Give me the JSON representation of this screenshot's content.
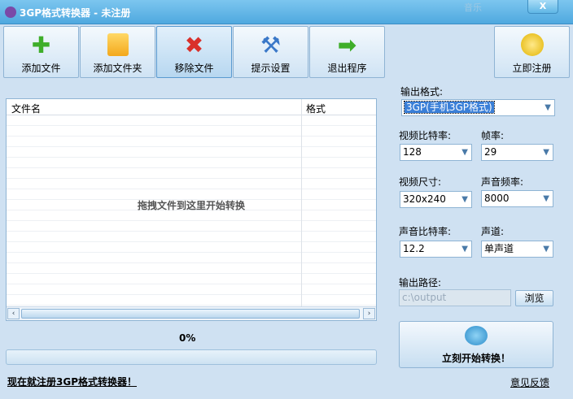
{
  "window": {
    "title": "3GP格式转换器 - 未注册",
    "music": "音乐",
    "close": "X"
  },
  "toolbar": [
    {
      "label": "添加文件",
      "icon": "plus-icon"
    },
    {
      "label": "添加文件夹",
      "icon": "folder-icon"
    },
    {
      "label": "移除文件",
      "icon": "x-icon"
    },
    {
      "label": "提示设置",
      "icon": "tools-icon"
    },
    {
      "label": "退出程序",
      "icon": "arrow-right-icon"
    }
  ],
  "register_button": "立即注册",
  "file_list": {
    "columns": [
      "文件名",
      "格式"
    ],
    "hint": "拖拽文件到这里开始转换"
  },
  "progress": {
    "text": "0%",
    "value": 0
  },
  "register_link": "现在就注册3GP格式转换器！",
  "settings": {
    "output_format": {
      "label": "输出格式:",
      "value": "3GP(手机3GP格式)"
    },
    "video_bitrate": {
      "label": "视频比特率:",
      "value": "128"
    },
    "frame_rate": {
      "label": "帧率:",
      "value": "29"
    },
    "video_size": {
      "label": "视频尺寸:",
      "value": "320x240"
    },
    "audio_rate": {
      "label": "声音频率:",
      "value": "8000"
    },
    "audio_bitrate": {
      "label": "声音比特率:",
      "value": "12.2"
    },
    "channel": {
      "label": "声道:",
      "value": "单声道"
    },
    "output_path": {
      "label": "输出路径:",
      "value": "c:\\output"
    },
    "browse": "浏览"
  },
  "start_button": "立刻开始转换！",
  "feedback": "意见反馈"
}
